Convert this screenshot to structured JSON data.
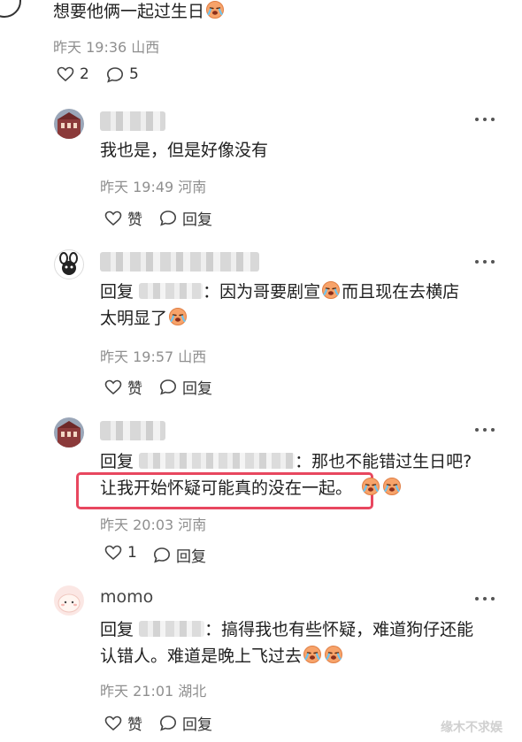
{
  "top": {
    "text": "想要他俩一起过生日",
    "time": "昨天 19:36",
    "region": "山西",
    "likes": "2",
    "replies": "5"
  },
  "comments": [
    {
      "name": "",
      "text": "我也是，但是好像没有",
      "time": "昨天 19:49",
      "region": "河南",
      "like_label": "赞",
      "reply_label": "回复"
    },
    {
      "name": "",
      "reply_prefix": "回复",
      "text": "：因为哥要剧宣",
      "text2": "而且现在去横店",
      "text3": "太明显了",
      "time": "昨天 19:57",
      "region": "山西",
      "like_label": "赞",
      "reply_label": "回复"
    },
    {
      "name": "",
      "reply_prefix": "回复",
      "text": "：那也不能错过生日吧?",
      "highlight": "让我开始怀疑可能真的没在一起。",
      "time": "昨天 20:03",
      "region": "河南",
      "likes": "1",
      "reply_label": "回复"
    },
    {
      "name": "momo",
      "reply_prefix": "回复",
      "text": "：搞得我也有些怀疑，难道狗仔还能",
      "text2": "认错人。难道是晚上飞过去",
      "time": "昨天 21:01",
      "region": "湖北",
      "like_label": "赞",
      "reply_label": "回复"
    }
  ],
  "watermark": "缘木不求娱",
  "colors": {
    "highlight": "#e8475f",
    "meta": "#8f8f8f"
  },
  "icons": [
    "heart-icon",
    "comment-icon",
    "more-icon",
    "crying-emoji"
  ]
}
